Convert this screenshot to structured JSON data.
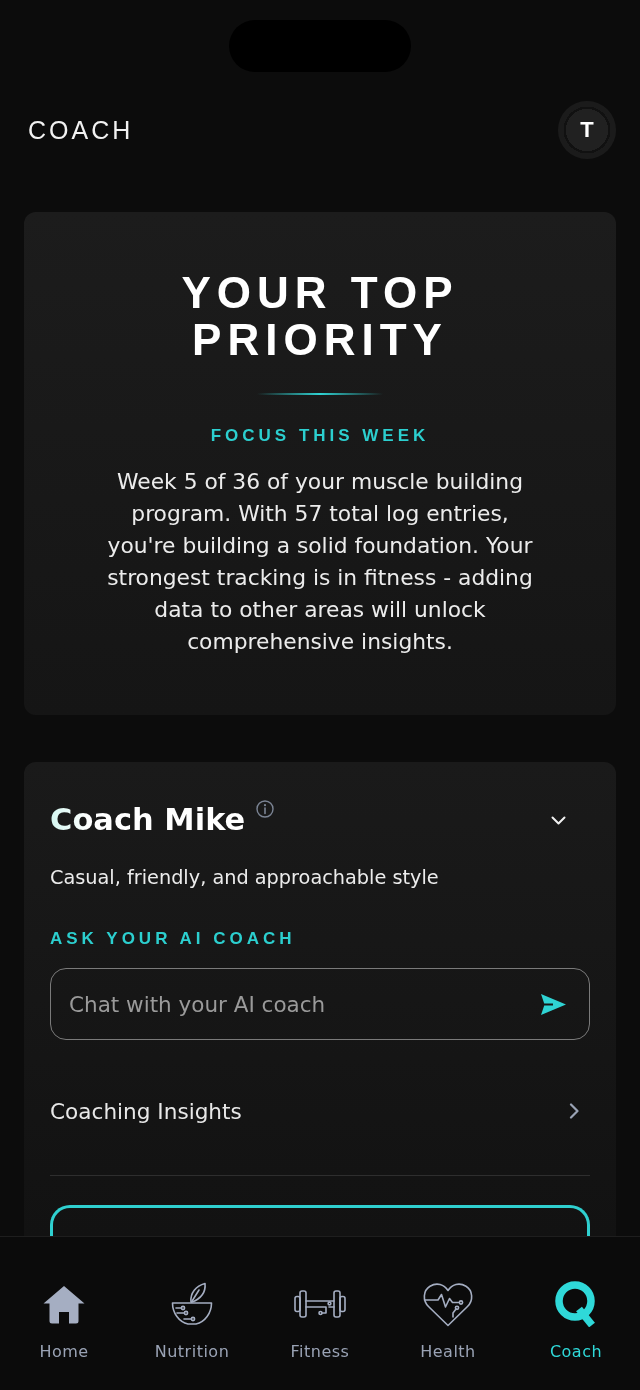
{
  "header": {
    "title": "COACH",
    "avatar_initial": "T"
  },
  "priority_card": {
    "title": "YOUR TOP PRIORITY",
    "label": "FOCUS THIS WEEK",
    "text": "Week 5 of 36 of your muscle building program. With 57 total log entries, you're building a solid foundation. Your strongest tracking is in fitness - adding data to other areas will unlock comprehensive insights."
  },
  "coach_card": {
    "name": "Coach Mike",
    "description": "Casual, friendly, and approachable style",
    "ask_label": "ASK YOUR AI COACH",
    "chat_input": {
      "placeholder": "Chat with your AI coach"
    },
    "insights_link": "Coaching Insights"
  },
  "tabs": [
    {
      "label": "Home",
      "kind": "home",
      "selected": false
    },
    {
      "label": "Nutrition",
      "kind": "nutrition",
      "selected": false
    },
    {
      "label": "Fitness",
      "kind": "fitness",
      "selected": false
    },
    {
      "label": "Health",
      "kind": "health",
      "selected": false
    },
    {
      "label": "Coach",
      "kind": "coach",
      "selected": true
    }
  ]
}
